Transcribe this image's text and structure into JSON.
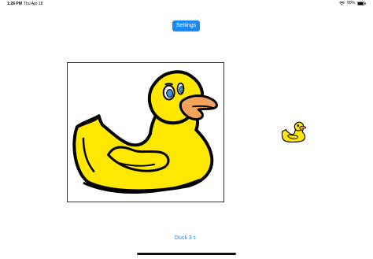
{
  "status_bar": {
    "time": "1:26 PM",
    "date": "Thu Apr 18",
    "battery_percent": "90%",
    "battery_level": 0.9,
    "icons": [
      "wifi-icon",
      "battery-icon"
    ]
  },
  "toolbar": {
    "settings_label": "Settings"
  },
  "main": {
    "selected_image": "duck-image",
    "thumbnail": "duck-thumbnail"
  },
  "picker": {
    "selected_value": "Duck 3",
    "icon": "chevron-updown-icon"
  },
  "colors": {
    "accent": "#1a8af2",
    "duck_yellow": "#ffe800",
    "beak_orange": "#f2a25a",
    "eye_blue": "#3c8fd8"
  }
}
